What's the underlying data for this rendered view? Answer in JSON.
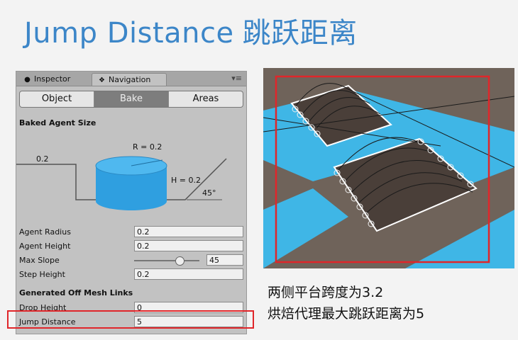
{
  "slide": {
    "title_en": "Jump Distance",
    "title_cn": "跳跃距离"
  },
  "tabs": {
    "inspector": "Inspector",
    "navigation": "Navigation"
  },
  "segment": {
    "object": "Object",
    "bake": "Bake",
    "areas": "Areas",
    "active": "Bake"
  },
  "baked_agent_size": {
    "heading": "Baked Agent Size",
    "diagram": {
      "left_value": "0.2",
      "radius": "R = 0.2",
      "height": "H = 0.2",
      "angle": "45°"
    },
    "fields": {
      "agent_radius": {
        "label": "Agent Radius",
        "value": "0.2"
      },
      "agent_height": {
        "label": "Agent Height",
        "value": "0.2"
      },
      "max_slope": {
        "label": "Max Slope",
        "value": "45",
        "slider_fraction": 0.7
      },
      "step_height": {
        "label": "Step Height",
        "value": "0.2"
      }
    }
  },
  "off_mesh_links": {
    "heading": "Generated Off Mesh Links",
    "drop_height": {
      "label": "Drop Height",
      "value": "0"
    },
    "jump_distance": {
      "label": "Jump Distance",
      "value": "5"
    }
  },
  "captions": {
    "line1": "两侧平台跨度为3.2",
    "line2": "烘焙代理最大跳跃距离为5"
  },
  "colors": {
    "title": "#3c86c8",
    "highlight": "#e0262a",
    "navmesh": "#3fb6e6",
    "agent": "#2f9fe0"
  }
}
